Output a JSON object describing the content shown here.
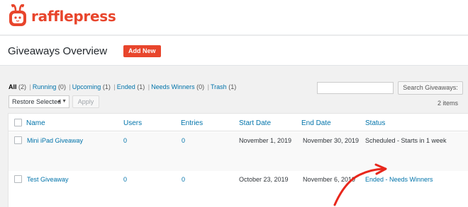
{
  "brand": {
    "name": "rafflepress",
    "color": "#e8452c"
  },
  "header": {
    "title": "Giveaways Overview",
    "add_new_label": "Add New"
  },
  "filters": [
    {
      "label": "All",
      "count": "(2)",
      "current": true
    },
    {
      "label": "Running",
      "count": "(0)"
    },
    {
      "label": "Upcoming",
      "count": "(1)"
    },
    {
      "label": "Ended",
      "count": "(1)"
    },
    {
      "label": "Needs Winners",
      "count": "(0)"
    },
    {
      "label": "Trash",
      "count": "(1)"
    }
  ],
  "search": {
    "button_label": "Search Giveaways:",
    "value": ""
  },
  "bulk": {
    "selected": "Restore Selected",
    "apply_label": "Apply"
  },
  "items_count": "2 items",
  "table": {
    "columns": [
      "Name",
      "Users",
      "Entries",
      "Start Date",
      "End Date",
      "Status"
    ],
    "rows": [
      {
        "name": "Mini iPad Giveaway",
        "users": "0",
        "entries": "0",
        "start": "November 1, 2019",
        "end": "November 30, 2019",
        "status": "Scheduled - Starts in 1 week"
      },
      {
        "name": "Test Giveaway",
        "users": "0",
        "entries": "0",
        "start": "October 23, 2019",
        "end": "November 6, 2019",
        "status": "Ended - Needs Winners"
      }
    ]
  },
  "annotation_color": "#e8271c"
}
